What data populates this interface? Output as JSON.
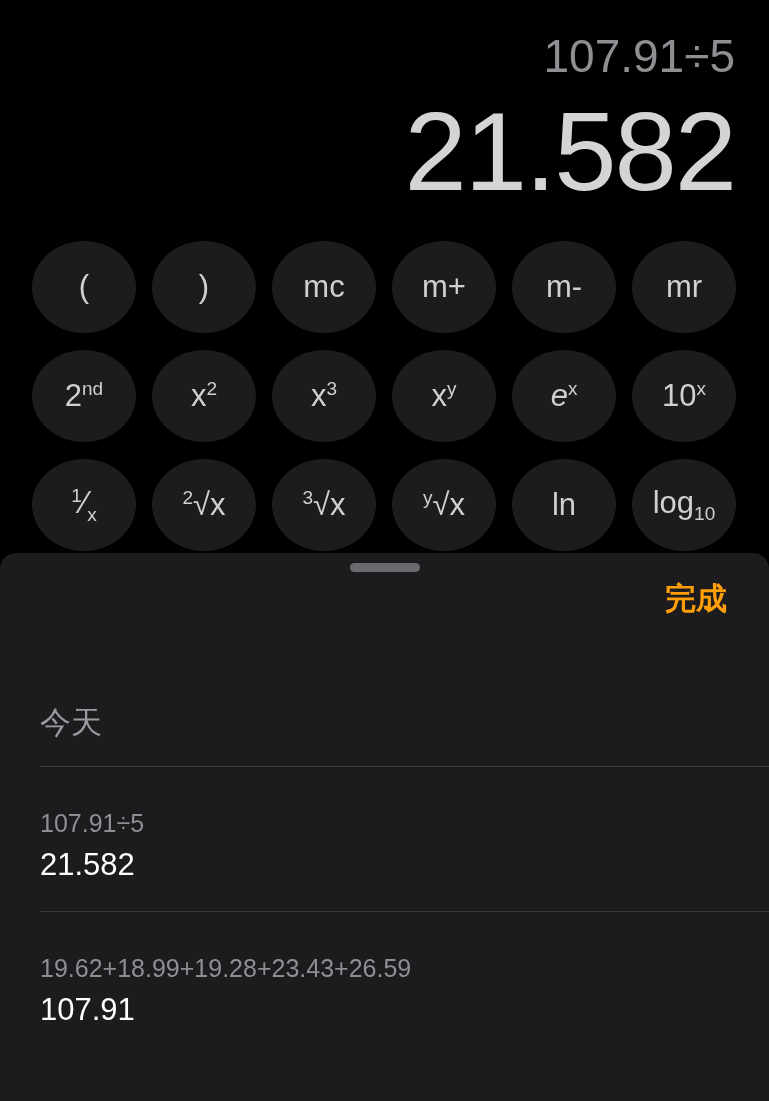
{
  "display": {
    "expression": "107.91÷5",
    "result": "21.582"
  },
  "keys": [
    {
      "label": "("
    },
    {
      "label": ")"
    },
    {
      "label": "mc"
    },
    {
      "label": "m+"
    },
    {
      "label": "m-"
    },
    {
      "label": "mr"
    },
    {
      "label": "2$^{nd}$"
    },
    {
      "label": "x$^{2}$"
    },
    {
      "label": "x$^{3}$"
    },
    {
      "label": "x$^{y}$"
    },
    {
      "label": "*e*$^{x}$"
    },
    {
      "label": "10$^{x}$"
    },
    {
      "label": "$^{1}$⁄$_{x}$"
    },
    {
      "label": "$^{2}$√x"
    },
    {
      "label": "$^{3}$√x"
    },
    {
      "label": "$^{y}$√x"
    },
    {
      "label": "ln"
    },
    {
      "label": "log$_{10}$"
    }
  ],
  "history_sheet": {
    "done_button": "完成",
    "section_title": "今天",
    "entries": [
      {
        "expression": "107.91÷5",
        "result": "21.582"
      },
      {
        "expression": "19.62+18.99+19.28+23.43+26.59",
        "result": "107.91"
      }
    ]
  }
}
